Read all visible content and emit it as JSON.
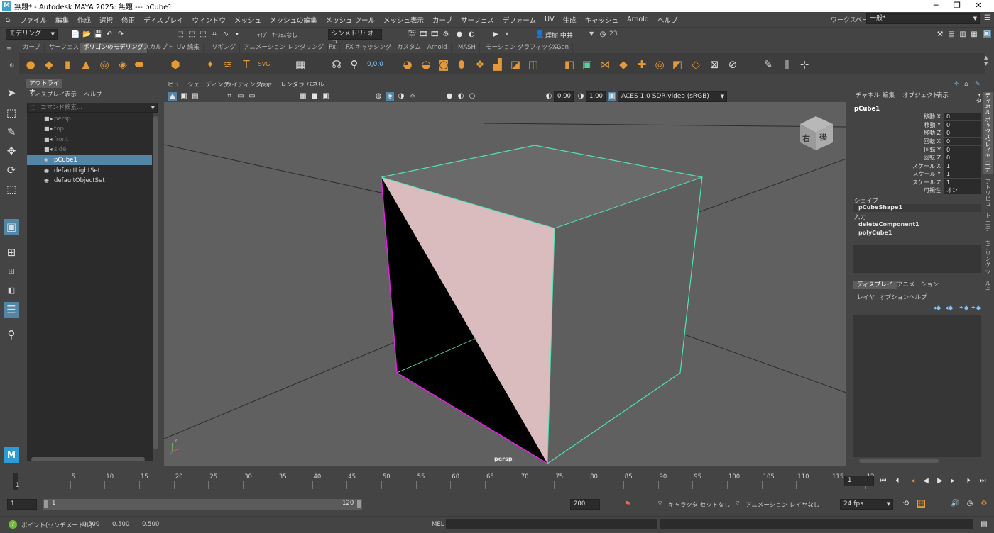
{
  "title": {
    "app_icon": "M",
    "text": "無題* - Autodesk MAYA 2025: 無題   ---   pCube1",
    "minimize": "─",
    "maximize": "❐",
    "close": "✕"
  },
  "menubar": {
    "items": [
      "ファイル",
      "編集",
      "作成",
      "選択",
      "修正",
      "ディスプレイ",
      "ウィンドウ",
      "メッシュ",
      "メッシュの編集",
      "メッシュ ツール",
      "メッシュ表示",
      "カーブ",
      "サーフェス",
      "デフォーム",
      "UV",
      "生成",
      "キャッシュ",
      "Arnold",
      "ヘルプ"
    ],
    "workspace_label": "ワークスペース:",
    "workspace_value": "一般*"
  },
  "statusline": {
    "mode": "モデリング",
    "live_label": "ﾗｲﾌﾞ",
    "live_value": "ｻｰﾌｪｽなし",
    "symmetry": "シンメトリ: オフ",
    "user": "理樹 中井",
    "notifications": "23"
  },
  "shelf": {
    "tabs": [
      "カーブ",
      "サーフェス",
      "ポリゴンのモデリング",
      "スカルプト",
      "UV 編集",
      "リギング",
      "アニメーション",
      "レンダリング",
      "Fx",
      "FX キャッシング",
      "カスタム",
      "Arnold",
      "MASH",
      "モーション グラフィックス",
      "XGen"
    ],
    "active_tab": "ポリゴンのモデリング"
  },
  "outliner": {
    "title": "アウトライナ",
    "menu": [
      "ディスプレイ",
      "表示",
      "ヘルプ"
    ],
    "search_placeholder": "コマンド検索...",
    "items": [
      {
        "label": "persp",
        "icon": "camera-icon",
        "dim": true
      },
      {
        "label": "top",
        "icon": "camera-icon",
        "dim": true
      },
      {
        "label": "front",
        "icon": "camera-icon",
        "dim": true
      },
      {
        "label": "side",
        "icon": "camera-icon",
        "dim": true
      },
      {
        "label": "pCube1",
        "icon": "mesh-icon",
        "selected": true
      },
      {
        "label": "defaultLightSet",
        "icon": "set-icon"
      },
      {
        "label": "defaultObjectSet",
        "icon": "set-icon"
      }
    ]
  },
  "viewport": {
    "menu": [
      "ビュー",
      "シェーディング",
      "ライティング",
      "表示",
      "レンダラ",
      "パネル"
    ],
    "exposure": "0.00",
    "gamma": "1.00",
    "color_space": "ACES 1.0 SDR-video (sRGB)",
    "camera_label": "persp",
    "viewcube_right": "右",
    "viewcube_back": "後",
    "axis_y": "Y",
    "axis_x": "X"
  },
  "channelbox": {
    "menu": [
      "チャネル",
      "編集",
      "オブジェクト",
      "表示"
    ],
    "object": "pCube1",
    "attributes": [
      {
        "name": "移動 X",
        "value": "0"
      },
      {
        "name": "移動 Y",
        "value": "0"
      },
      {
        "name": "移動 Z",
        "value": "0"
      },
      {
        "name": "回転 X",
        "value": "0"
      },
      {
        "name": "回転 Y",
        "value": "0"
      },
      {
        "name": "回転 Z",
        "value": "0"
      },
      {
        "name": "スケール X",
        "value": "1"
      },
      {
        "name": "スケール Y",
        "value": "1"
      },
      {
        "name": "スケール Z",
        "value": "1"
      },
      {
        "name": "可視性",
        "value": "オン"
      }
    ],
    "shapes_label": "シェイプ",
    "shape": "pCubeShape1",
    "inputs_label": "入力",
    "inputs": [
      "deleteComponent1",
      "polyCube1"
    ],
    "side_tabs": [
      "チャネル ボックス/レイヤ エディタ",
      "アトリビュート エディタ",
      "モデリング ツールキット"
    ]
  },
  "layers": {
    "tabs": [
      "ディスプレイ",
      "アニメーション"
    ],
    "active_tab": "ディスプレイ",
    "menu": [
      "レイヤ",
      "オプション",
      "ヘルプ"
    ]
  },
  "timeline": {
    "ticks": [
      "5",
      "10",
      "15",
      "20",
      "25",
      "30",
      "35",
      "40",
      "45",
      "50",
      "55",
      "60",
      "65",
      "70",
      "75",
      "80",
      "85",
      "90",
      "95",
      "100",
      "105",
      "110",
      "115",
      "12"
    ],
    "start_marker": "1",
    "current_frame": "1"
  },
  "range": {
    "start": "1",
    "inner_start": "1",
    "inner_end": "120",
    "end": "200",
    "character_set": "キャラクタ セットなし",
    "anim_layer": "アニメーション レイヤなし",
    "fps": "24 fps"
  },
  "commandline": {
    "help_text": "ポイント(センチメートル):",
    "x": "0.500",
    "y": "0.500",
    "z": "0.500",
    "mel_label": "MEL"
  }
}
